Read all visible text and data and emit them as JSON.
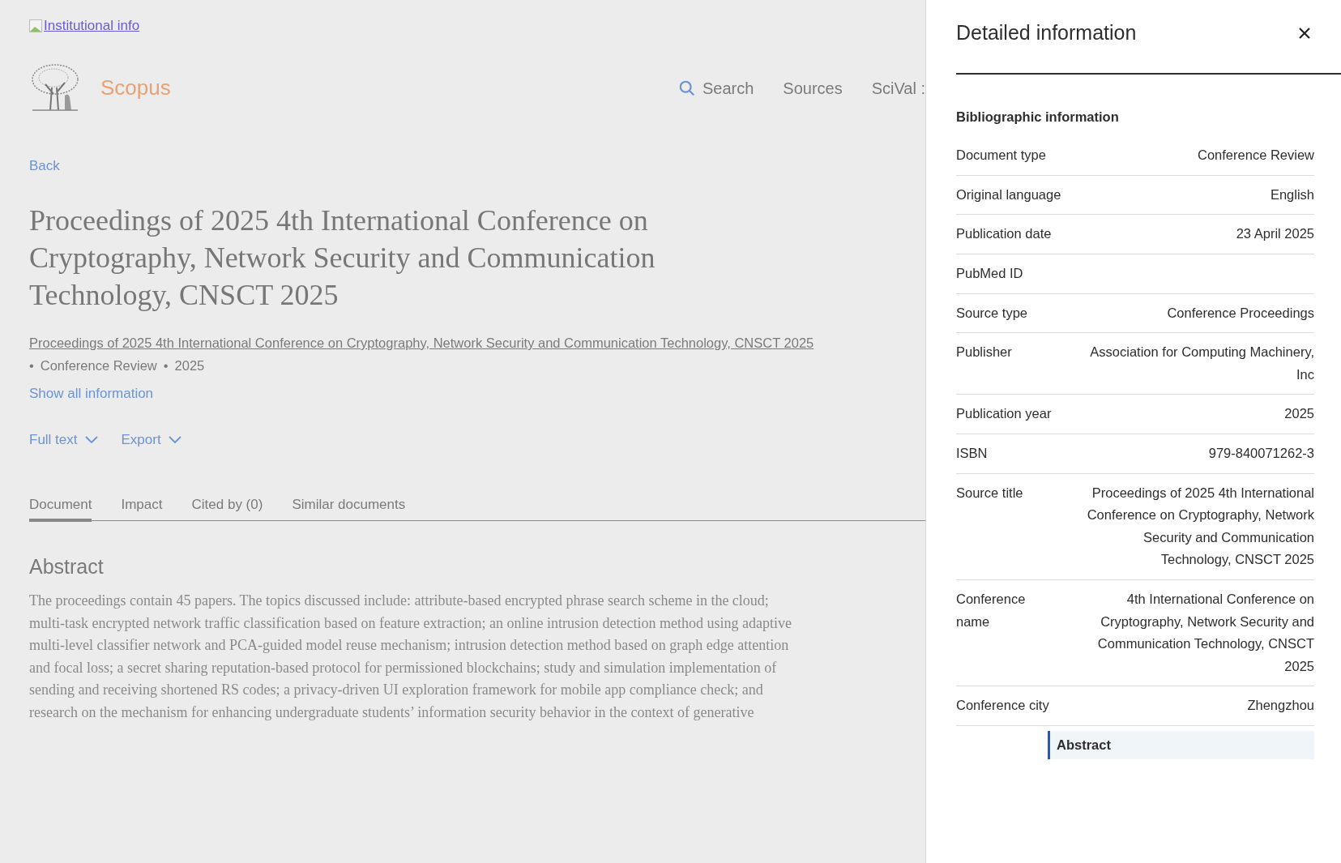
{
  "institutional_link": "Institutional info",
  "header": {
    "brand": "Scopus",
    "nav": [
      "Search",
      "Sources",
      "SciVal :"
    ]
  },
  "back_link": "Back",
  "document": {
    "title": "Proceedings of 2025 4th International Conference on Cryptography, Network Security and Communication Technology, CNSCT 2025",
    "source_link": "Proceedings of 2025 4th International Conference on Cryptography, Network Security and Communication Technology, CNSCT 2025",
    "meta": [
      "Conference Review",
      "2025"
    ],
    "meta_separator": "•",
    "show_all": "Show all information",
    "actions": [
      "Full text",
      "Export"
    ]
  },
  "tabs": [
    {
      "label": "Document",
      "selected": true
    },
    {
      "label": "Impact",
      "selected": false
    },
    {
      "label": "Cited by (0)",
      "selected": false
    },
    {
      "label": "Similar documents",
      "selected": false
    }
  ],
  "abstract": {
    "heading": "Abstract",
    "text": "The proceedings contain 45 papers. The topics discussed include: attribute-based encrypted phrase search scheme in the cloud; multi-task encrypted network traffic classification based on feature extraction; an online intrusion detection method using adaptive multi-level classifier network and PCA-guided model reuse mechanism; intrusion detection method based on graph edge attention and focal loss; a secret sharing reputation-based protocol for permissioned blockchains; study and simulation implementation of sending and receiving shortened RS codes; a privacy-driven UI exploration framework for mobile app compliance check; and research on the mechanism for enhancing undergraduate students’ information security behavior in the context of generative"
  },
  "panel": {
    "title": "Detailed information",
    "section": "Bibliographic information",
    "rows": [
      {
        "label": "Document type",
        "value": "Conference Review"
      },
      {
        "label": "Original language",
        "value": "English"
      },
      {
        "label": "Publication date",
        "value": "23 April 2025"
      },
      {
        "label": "PubMed ID"
      },
      {
        "label": "Source type",
        "value": "Conference Proceedings"
      },
      {
        "label": "Publisher",
        "value": "Association for Computing Machinery, Inc"
      },
      {
        "label": "Publication year",
        "value": "2025"
      },
      {
        "label": "ISBN",
        "value": "979-840071262-3"
      },
      {
        "label": "Source title",
        "value": "Proceedings of 2025 4th International Conference on Cryptography, Network Security and Communication Technology, CNSCT 2025"
      },
      {
        "label": "Conference name",
        "value": "4th International Conference on Cryptography, Network Security and Communication Technology, CNSCT 2025"
      },
      {
        "label": "Conference city",
        "value": "Zhengzhou"
      }
    ],
    "next_section": "Abstract"
  }
}
